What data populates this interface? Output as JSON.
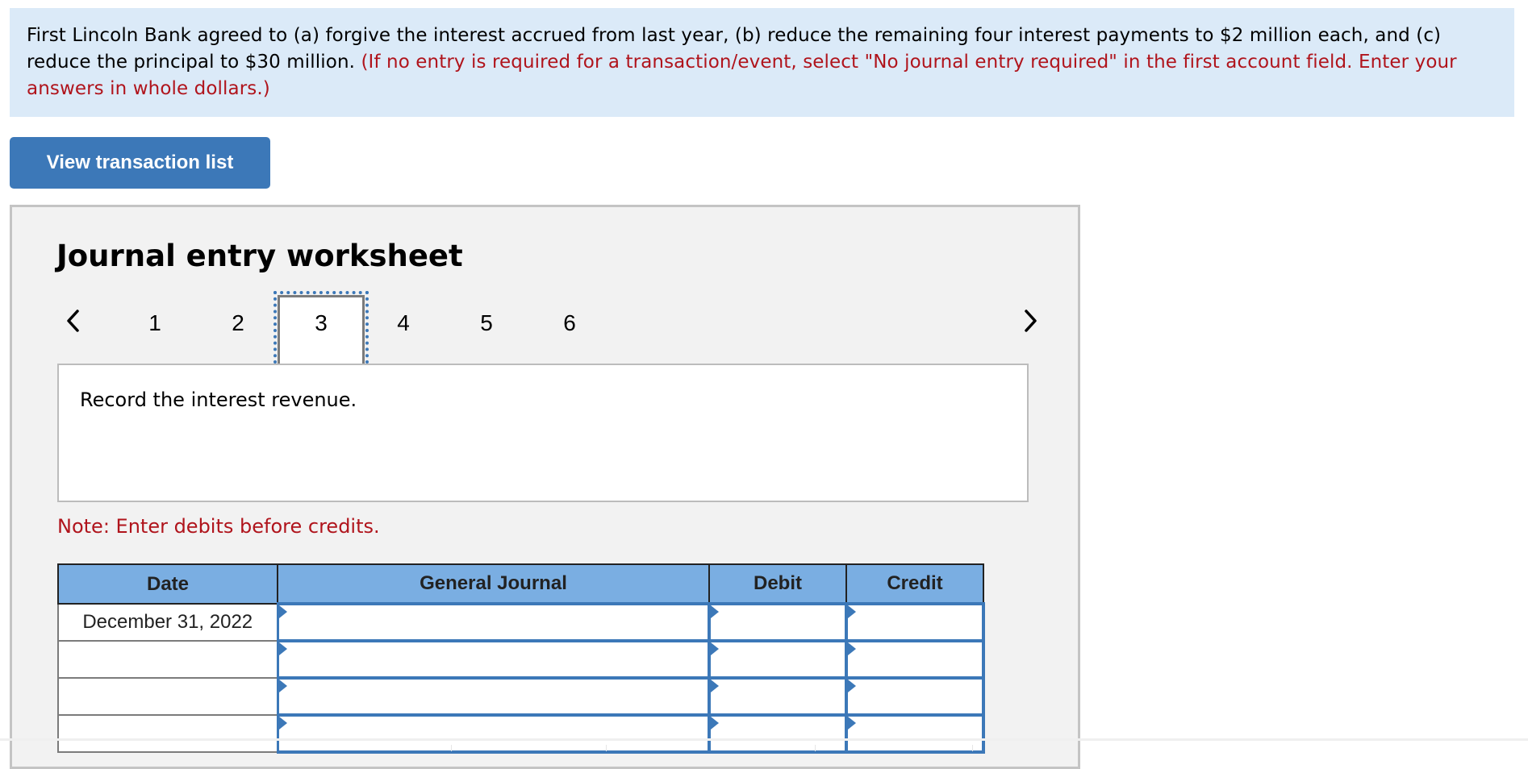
{
  "instructions": {
    "main_text": "First Lincoln Bank agreed to (a) forgive the interest accrued from last year, (b) reduce the remaining four interest payments to $2 million each, and (c) reduce the principal to $30 million.",
    "red_text": "(If no entry is required for a transaction/event, select \"No journal entry required\" in the first account field. Enter your answers in whole dollars.)"
  },
  "buttons": {
    "view_transaction_list": "View transaction list"
  },
  "worksheet": {
    "title": "Journal entry worksheet",
    "nav": {
      "prev_icon": "chevron-left-icon",
      "next_icon": "chevron-right-icon",
      "items": [
        "1",
        "2",
        "3",
        "4",
        "5",
        "6"
      ],
      "active_index": 2
    },
    "description": "Record the interest revenue.",
    "note": "Note: Enter debits before credits.",
    "table": {
      "columns": [
        "Date",
        "General Journal",
        "Debit",
        "Credit"
      ],
      "rows": [
        {
          "date": "December 31, 2022",
          "account": "",
          "debit": "",
          "credit": ""
        },
        {
          "date": "",
          "account": "",
          "debit": "",
          "credit": ""
        },
        {
          "date": "",
          "account": "",
          "debit": "",
          "credit": ""
        },
        {
          "date": "",
          "account": "",
          "debit": "",
          "credit": ""
        }
      ]
    }
  },
  "colors": {
    "instruction_bg": "#dbeaf8",
    "instruction_red": "#b0141c",
    "button_blue": "#3c78b8",
    "table_header_bg": "#7aaee2",
    "panel_bg": "#f2f2f2"
  }
}
